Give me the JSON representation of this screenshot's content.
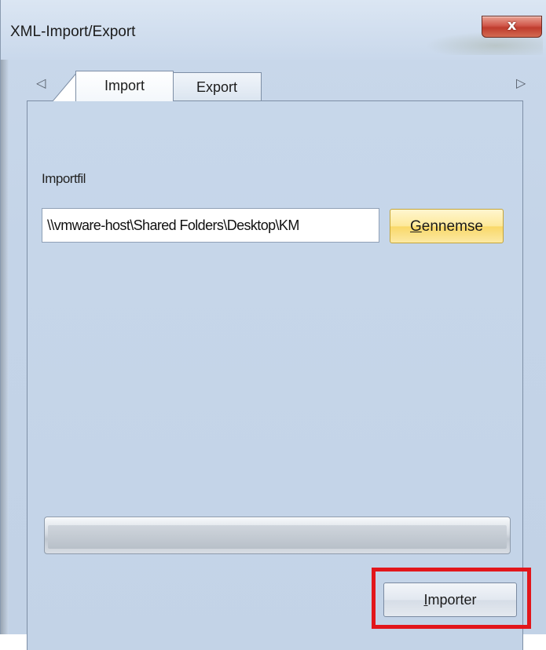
{
  "window": {
    "title": "XML-Import/Export",
    "close_glyph": "x"
  },
  "tabs": {
    "scroll_left_icon": "◁",
    "scroll_right_icon": "▷",
    "items": [
      {
        "label": "Import",
        "active": true
      },
      {
        "label": "Export",
        "active": false
      }
    ]
  },
  "import": {
    "file_label": "Importfil",
    "file_path": "\\\\vmware-host\\Shared Folders\\Desktop\\KM",
    "browse_label_accel": "G",
    "browse_label_rest": "ennemse",
    "progress_percent": 0,
    "import_label_accel": "I",
    "import_label_rest": "mporter"
  },
  "colors": {
    "highlight": "#e2161b",
    "browse_button": "#fde99a",
    "close_button": "#cf5647"
  }
}
